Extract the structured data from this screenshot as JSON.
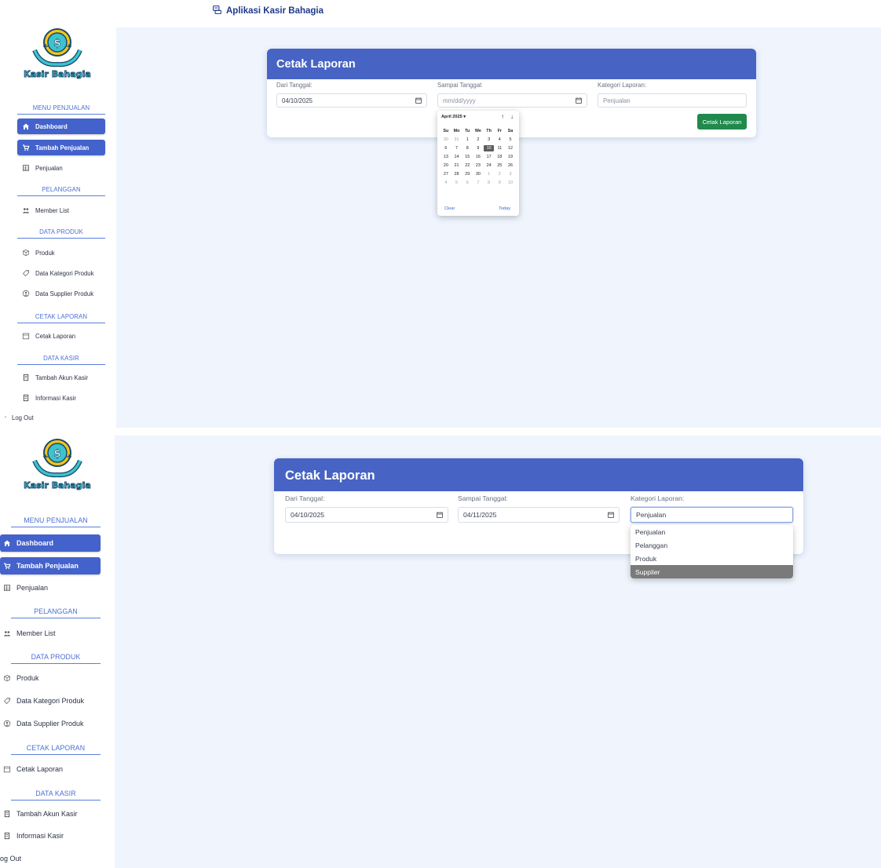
{
  "app": {
    "title": "Aplikasi Kasir Bahagia"
  },
  "logo": {
    "text": "Kasir Bahagia"
  },
  "sidebar": {
    "sections": {
      "penjualan": "MENU PENJUALAN",
      "pelanggan": "PELANGGAN",
      "produk": "DATA PRODUK",
      "laporan": "CETAK LAPORAN",
      "kasir": "DATA KASIR"
    },
    "items": {
      "dashboard": "Dashboard",
      "tambah_penjualan": "Tambah Penjualan",
      "penjualan": "Penjualan",
      "member_list": "Member List",
      "produk": "Produk",
      "kategori": "Data Kategori Produk",
      "supplier": "Data Supplier Produk",
      "cetak_laporan": "Cetak Laporan",
      "tambah_kasir": "Tambah Akun Kasir",
      "info_kasir": "Informasi Kasir"
    },
    "logout_top": "Log Out",
    "logout_bottom": "og Out"
  },
  "form": {
    "title": "Cetak Laporan",
    "from_label": "Dari Tanggal:",
    "to_label": "Sampai Tanggal:",
    "category_label": "Kategori Laporan:",
    "submit_label": "Cetak Laporan"
  },
  "state1": {
    "from_value": "04/10/2025",
    "to_value": "mm/dd/yyyy",
    "category_value": "Penjualan"
  },
  "state2": {
    "from_value": "04/10/2025",
    "to_value": "04/11/2025",
    "category_value": "Penjualan"
  },
  "datepicker": {
    "month_label": "April 2025 ▾",
    "up_arrow": "↑",
    "down_arrow": "↓",
    "weekdays": [
      "Su",
      "Mo",
      "Tu",
      "We",
      "Th",
      "Fr",
      "Sa"
    ],
    "days": [
      [
        "30",
        "31",
        "1",
        "2",
        "3",
        "4",
        "5"
      ],
      [
        "6",
        "7",
        "8",
        "9",
        "10",
        "11",
        "12"
      ],
      [
        "13",
        "14",
        "15",
        "16",
        "17",
        "18",
        "19"
      ],
      [
        "20",
        "21",
        "22",
        "23",
        "24",
        "25",
        "26"
      ],
      [
        "27",
        "28",
        "29",
        "30",
        "1",
        "2",
        "3"
      ],
      [
        "4",
        "5",
        "6",
        "7",
        "8",
        "9",
        "10"
      ]
    ],
    "selected_day": "10",
    "clear_label": "Clear",
    "today_label": "Today"
  },
  "category_options": [
    "Penjualan",
    "Pelanggan",
    "Produk",
    "Supplier"
  ],
  "category_highlighted": "Supplier",
  "colors": {
    "primary": "#4763c4",
    "success": "#1f8a4c",
    "content_bg": "#eff4fd"
  }
}
